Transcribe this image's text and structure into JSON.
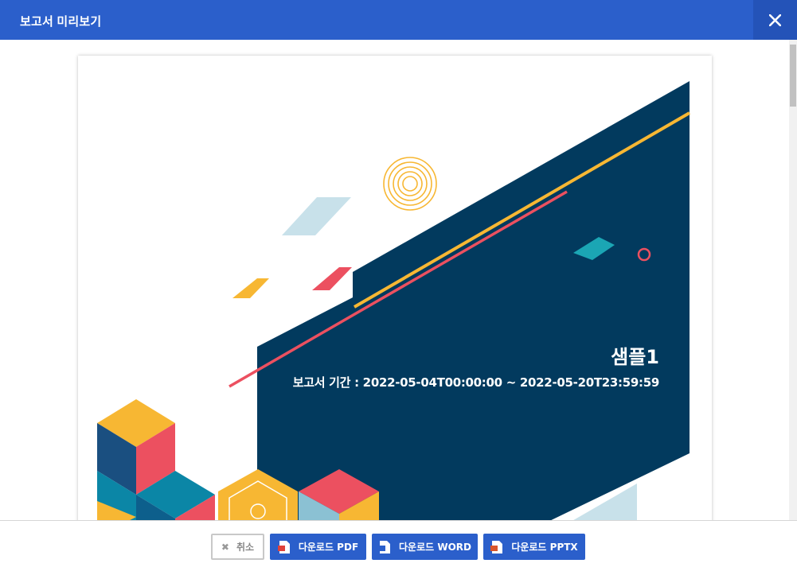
{
  "header": {
    "title": "보고서 미리보기",
    "close_icon": "close-icon"
  },
  "report": {
    "title": "샘플1",
    "period": "보고서 기간 : 2022-05-04T00:00:00 ~ 2022-05-20T23:59:59"
  },
  "colors": {
    "header_bg": "#2b5fcb",
    "navy": "#023a5e",
    "yellow": "#f7b733",
    "coral": "#ec5060",
    "teal": "#1ba6b4",
    "light_blue": "#c8e1ea"
  },
  "footer": {
    "cancel_label": "취소",
    "cancel_icon": "x-icon",
    "pdf_label": "다운로드 PDF",
    "pdf_icon": "pdf-file-icon",
    "word_label": "다운로드 WORD",
    "word_icon": "word-file-icon",
    "pptx_label": "다운로드 PPTX",
    "pptx_icon": "pptx-file-icon"
  }
}
